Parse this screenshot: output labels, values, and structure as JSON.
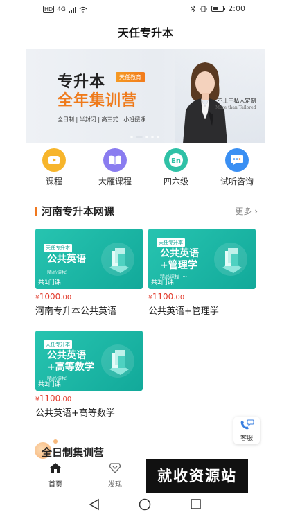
{
  "status_bar": {
    "network_hd": "HD",
    "network_type": "4G",
    "time": "2:00"
  },
  "header": {
    "title": "天任专升本"
  },
  "banner": {
    "title_line1": "专升本",
    "tag": "天任教育",
    "title_line2": "全年集训营",
    "subtitle": "全日制 | 半封闭 | 高三式 | 小班授课",
    "slogan_cn": "不止于私人定制",
    "slogan_en": "More than Tailored"
  },
  "quick_nav": [
    {
      "label": "课程",
      "icon": "video-course-icon",
      "color": "#f7b52b"
    },
    {
      "label": "大雁课程",
      "icon": "book-icon",
      "color": "#8a7cf0"
    },
    {
      "label": "四六级",
      "icon": "english-en-icon",
      "color": "#2fc1a6"
    },
    {
      "label": "试听咨询",
      "icon": "chat-bubble-icon",
      "color": "#3a8ff3"
    }
  ],
  "section_online": {
    "title": "河南专升本网课",
    "more": "更多"
  },
  "courses": [
    {
      "thumb_tag": "天任专升本",
      "thumb_title_line1": "公共英语",
      "thumb_title_line2": "",
      "thumb_sub": "精品课程 ····",
      "count": "共1门课",
      "price_symbol": "¥",
      "price_int": "1000",
      "price_dec": ".00",
      "title": "河南专升本公共英语"
    },
    {
      "thumb_tag": "天任专升本",
      "thumb_title_line1": "公共英语",
      "thumb_title_line2": "+管理学",
      "thumb_sub": "精品课程 ····",
      "count": "共2门课",
      "price_symbol": "¥",
      "price_int": "1100",
      "price_dec": ".00",
      "title": "公共英语+管理学"
    },
    {
      "thumb_tag": "天任专升本",
      "thumb_title_line1": "公共英语",
      "thumb_title_line2": "+高等数学",
      "thumb_sub": "精品课程 ····",
      "count": "共2门课",
      "price_symbol": "¥",
      "price_int": "1100",
      "price_dec": ".00",
      "title": "公共英语+高等数学"
    }
  ],
  "customer_service": {
    "label": "客服"
  },
  "section_camp": {
    "title": "全日制集训营"
  },
  "tabbar": [
    {
      "label": "首页",
      "icon": "home-icon",
      "active": true
    },
    {
      "label": "发现",
      "icon": "discover-icon",
      "active": false
    }
  ],
  "watermark": {
    "text": "就收资源站"
  },
  "colors": {
    "accent": "#f0781e",
    "price": "#e23b2c",
    "card_teal": "#1bb5a4"
  }
}
